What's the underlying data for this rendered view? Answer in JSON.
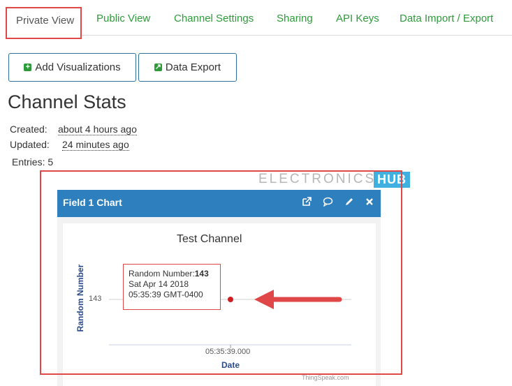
{
  "tabs": {
    "active": "Private View",
    "items": [
      "Public View",
      "Channel Settings",
      "Sharing",
      "API Keys",
      "Data Import / Export"
    ]
  },
  "buttons": {
    "add_visualizations": "Add Visualizations",
    "data_export": "Data Export"
  },
  "channel_stats": {
    "title": "Channel Stats",
    "created_label": "Created:",
    "created_value": "about 4 hours ago",
    "updated_label": "Updated:",
    "updated_value": "24 minutes ago",
    "entries": "Entries: 5"
  },
  "watermark": {
    "text": "ELECTRONICS",
    "badge": "HUB"
  },
  "panel": {
    "title": "Field 1 Chart",
    "icons": [
      "external-link-icon",
      "comment-icon",
      "pencil-icon",
      "close-icon"
    ]
  },
  "chart_data": {
    "type": "scatter",
    "title": "Test Channel",
    "xlabel": "Date",
    "ylabel": "Random Number",
    "x_ticks": [
      "05:35:39.000"
    ],
    "y_ticks": [
      "143"
    ],
    "points": [
      {
        "x": "Sat Apr 14 2018 05:35:39 GMT-0400",
        "y": 143
      }
    ],
    "tooltip": {
      "label": "Random Number:",
      "value": "143",
      "date": "Sat Apr 14 2018",
      "time": "05:35:39 GMT-0400"
    },
    "credit": "ThingSpeak.com",
    "colors": {
      "point": "#cc1f1f",
      "tabs": "#2e9a3a",
      "panel_header": "#2e7fbd",
      "highlight": "#e04848"
    }
  }
}
